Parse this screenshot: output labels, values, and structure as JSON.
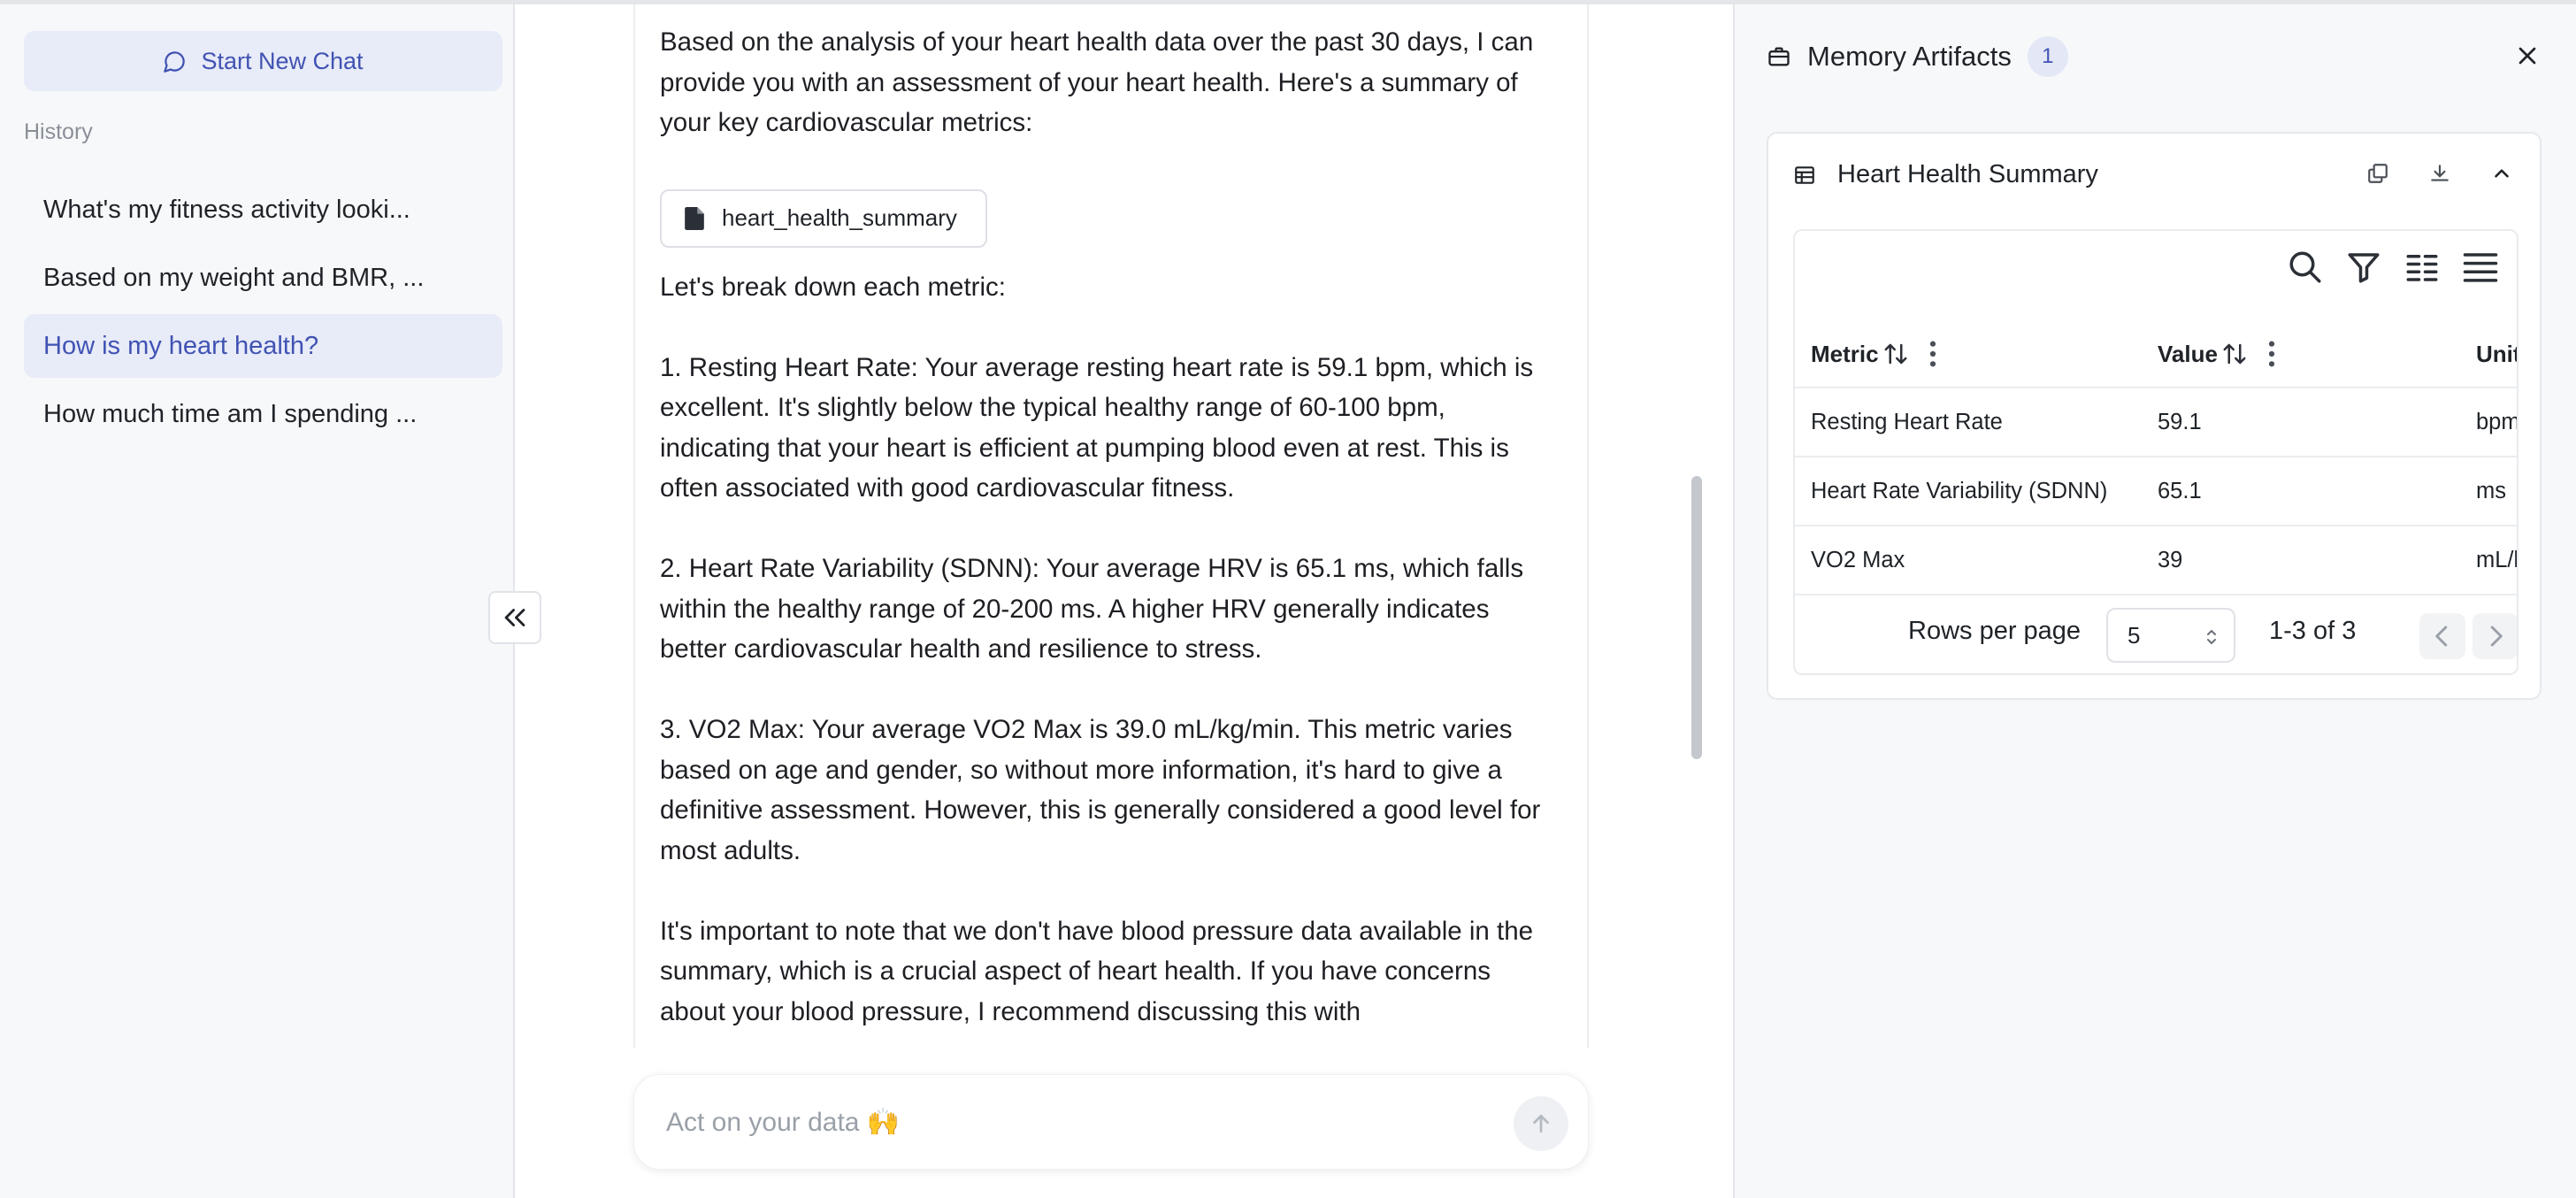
{
  "sidebar": {
    "new_chat_label": "Start New Chat",
    "history_label": "History",
    "items": [
      {
        "label": "What's my fitness activity looki..."
      },
      {
        "label": "Based on my weight and BMR, ..."
      },
      {
        "label": "How is my heart health?"
      },
      {
        "label": "How much time am I spending ..."
      }
    ],
    "active_index": 2
  },
  "chat": {
    "intro": "Based on the analysis of your heart health data over the past 30 days, I can provide you with an assessment of your heart health. Here's a summary of your key cardiovascular metrics:",
    "artifact_chip_label": "heart_health_summary",
    "breakdown_heading": "Let's break down each metric:",
    "p1": "1. Resting Heart Rate: Your average resting heart rate is 59.1 bpm, which is excellent. It's slightly below the typical healthy range of 60-100 bpm, indicating that your heart is efficient at pumping blood even at rest. This is often associated with good cardiovascular fitness.",
    "p2": "2. Heart Rate Variability (SDNN): Your average HRV is 65.1 ms, which falls within the healthy range of 20-200 ms. A higher HRV generally indicates better cardiovascular health and resilience to stress.",
    "p3": "3. VO2 Max: Your average VO2 Max is 39.0 mL/kg/min. This metric varies based on age and gender, so without more information, it's hard to give a definitive assessment. However, this is generally considered a good level for most adults.",
    "p4": "It's important to note that we don't have blood pressure data available in the summary, which is a crucial aspect of heart health. If you have concerns about your blood pressure, I recommend discussing this with"
  },
  "composer": {
    "placeholder": "Act on your data 🙌"
  },
  "right_panel": {
    "title": "Memory Artifacts",
    "count": "1",
    "card": {
      "title": "Heart Health Summary",
      "columns": [
        "Metric",
        "Value",
        "Unit"
      ],
      "rows": [
        {
          "metric": "Resting Heart Rate",
          "value": "59.1",
          "unit": "bpm"
        },
        {
          "metric": "Heart Rate Variability (SDNN)",
          "value": "65.1",
          "unit": "ms"
        },
        {
          "metric": "VO2 Max",
          "value": "39",
          "unit": "mL/kg/min"
        }
      ],
      "rows_per_page_label": "Rows per page",
      "rows_per_page_value": "5",
      "range_text": "1-3 of 3"
    }
  },
  "colors": {
    "accent": "#4053b3",
    "active_bg": "#e8ebf8",
    "panel_bg": "#f7f8fa"
  },
  "icons": {
    "new_chat": "chat-bubble-icon",
    "collapse": "double-chevron-left-icon",
    "chip": "file-icon",
    "send": "arrow-up-icon",
    "panel": "briefcase-icon",
    "close": "close-icon",
    "table": "table-icon",
    "copy": "copy-icon",
    "download": "download-icon",
    "collapse_card": "chevron-up-icon",
    "search": "search-icon",
    "filter": "filter-icon",
    "columns": "columns-icon",
    "density": "density-icon"
  }
}
